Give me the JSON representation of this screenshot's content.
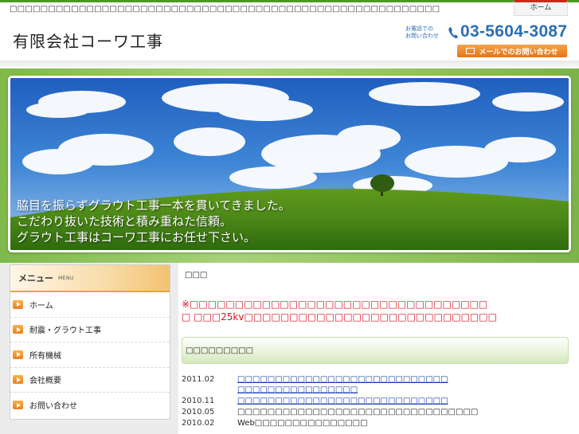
{
  "header": {
    "tagline": "□□□□□□□□□□□□□□□□□□□□□□□□□□□□□□□□□□□□□□□□□□□□□□□□□□□□□□□□",
    "home_tab": "ホーム",
    "company_name": "有限会社コーワ工事",
    "tel_caption_1": "お電話での",
    "tel_caption_2": "お問い合わせ",
    "tel_number": "03-5604-3087",
    "mail_button": "メールでのお問い合わせ"
  },
  "hero": {
    "lines": [
      "脇目を振らずグラウト工事一本を貫いてきました。",
      "こだわり抜いた技術と積み重ねた信頼。",
      "グラウト工事はコーワ工事にお任せ下さい。"
    ]
  },
  "sidebar": {
    "title": "メニュー",
    "subtitle": "MENU",
    "items": [
      {
        "label": "ホーム"
      },
      {
        "label": "耐震・グラウト工事"
      },
      {
        "label": "所有機械"
      },
      {
        "label": "会社概要"
      },
      {
        "label": "お問い合わせ"
      }
    ]
  },
  "main": {
    "section_label": "□□□",
    "notice_1": "※□□□□□□□□□□□□□□□□□□□□□□□□□□□□□□□□□",
    "notice_2": "□ □□□25kv□□□□□□□□□□□□□□□□□□□□□□□□□□□□",
    "news_heading": "□□□□□□□□□",
    "news": [
      {
        "date": "2011.02",
        "line1": "□□□□□□□□□□□□□□□□□□□□□□□□□□□□",
        "line2": "□□□□□□□□□□□□□□□□",
        "link": true
      },
      {
        "date": "2010.11",
        "line1": "□□□□□□□□□□□□□□□□□□□□□□□□□□□□",
        "line2": "",
        "link": true
      },
      {
        "date": "2010.05",
        "line1": "□□□□□□□□□□□□□□□□□□□□□□□□□□□□□□□□",
        "line2": "",
        "link": false
      },
      {
        "date": "2010.02",
        "line1": "Web□□□□□□□□□□□□□□□",
        "line2": "",
        "link": false
      }
    ]
  },
  "colors": {
    "brand_green": "#4a9a1e",
    "accent_blue": "#2a6fb4",
    "accent_orange": "#e2761a",
    "notice_red": "#d8121e",
    "link_blue": "#1a3fb0"
  },
  "icons": [
    "phone-icon",
    "mail-icon",
    "arrow-icon"
  ]
}
